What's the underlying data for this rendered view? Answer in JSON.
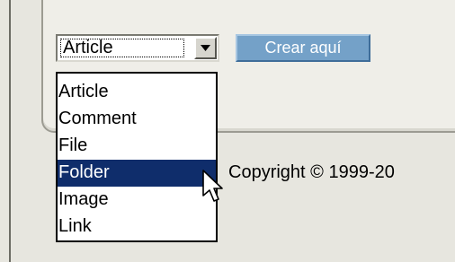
{
  "type_select": {
    "value": "Article",
    "options": [
      "Article",
      "Comment",
      "File",
      "Folder",
      "Image",
      "Link"
    ],
    "highlighted": "Folder"
  },
  "create_button": {
    "label": "Crear aquí"
  },
  "footer": {
    "copyright": "Copyright © 1999-20"
  },
  "colors": {
    "button_bg": "#74a1c8",
    "selection_bg": "#0f2d6b",
    "page_bg": "#e7e6df"
  }
}
